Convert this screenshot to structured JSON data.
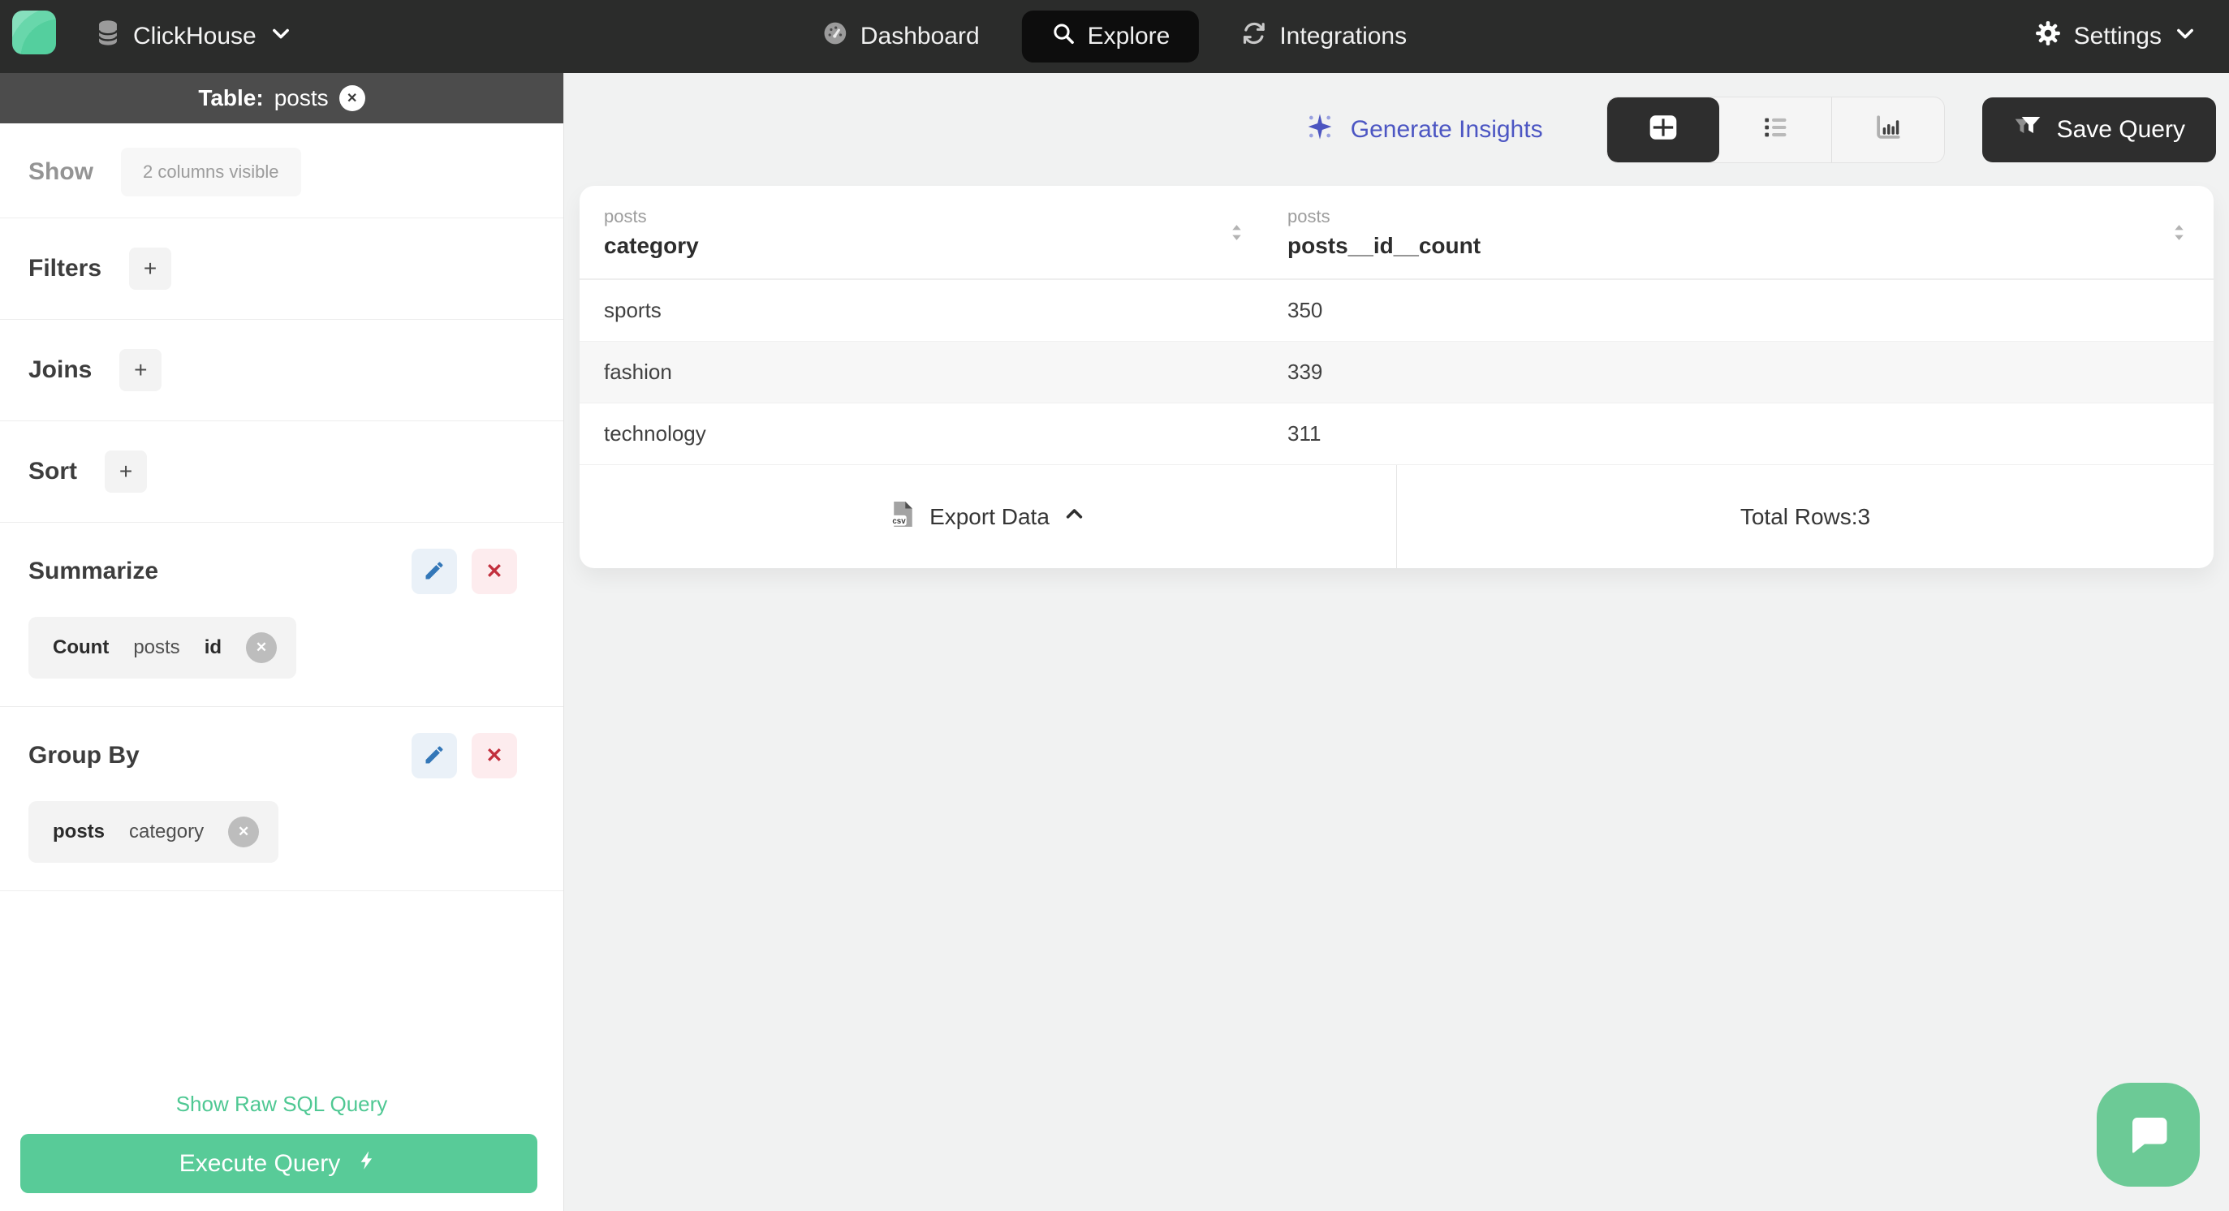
{
  "navbar": {
    "brand": "ClickHouse",
    "items": [
      {
        "label": "Dashboard"
      },
      {
        "label": "Explore"
      },
      {
        "label": "Integrations"
      }
    ],
    "settings": "Settings"
  },
  "sidebar": {
    "header": {
      "prefix": "Table:",
      "table": "posts",
      "close_glyph": "✕"
    },
    "show": {
      "label": "Show",
      "chip": "2 columns visible"
    },
    "sections": [
      {
        "label": "Filters",
        "add": "+"
      },
      {
        "label": "Joins",
        "add": "+"
      },
      {
        "label": "Sort",
        "add": "+"
      }
    ],
    "summarize": {
      "label": "Summarize",
      "remove_glyph": "✕",
      "chip": {
        "agg": "Count",
        "table": "posts",
        "field": "id",
        "remove_glyph": "✕"
      }
    },
    "group_by": {
      "label": "Group By",
      "remove_glyph": "✕",
      "chip": {
        "table": "posts",
        "field": "category",
        "remove_glyph": "✕"
      }
    },
    "raw_sql_link": "Show Raw SQL Query",
    "execute_button": "Execute Query"
  },
  "main": {
    "generate_insights": "Generate Insights",
    "save_query": "Save Query",
    "table": {
      "columns": [
        {
          "group": "posts",
          "name": "category"
        },
        {
          "group": "posts",
          "name": "posts__id__count"
        }
      ],
      "rows": [
        {
          "category": "sports",
          "count": "350"
        },
        {
          "category": "fashion",
          "count": "339"
        },
        {
          "category": "technology",
          "count": "311"
        }
      ]
    },
    "footer": {
      "export_label": "Export Data",
      "csv_label": "csv",
      "total_rows": "Total Rows:3"
    }
  },
  "colors": {
    "accent_green": "#58cb98",
    "accent_indigo": "#4c56c3",
    "danger_red": "#c22f3d",
    "edit_blue": "#3377b8",
    "navbar_bg": "#2b2c2b"
  }
}
